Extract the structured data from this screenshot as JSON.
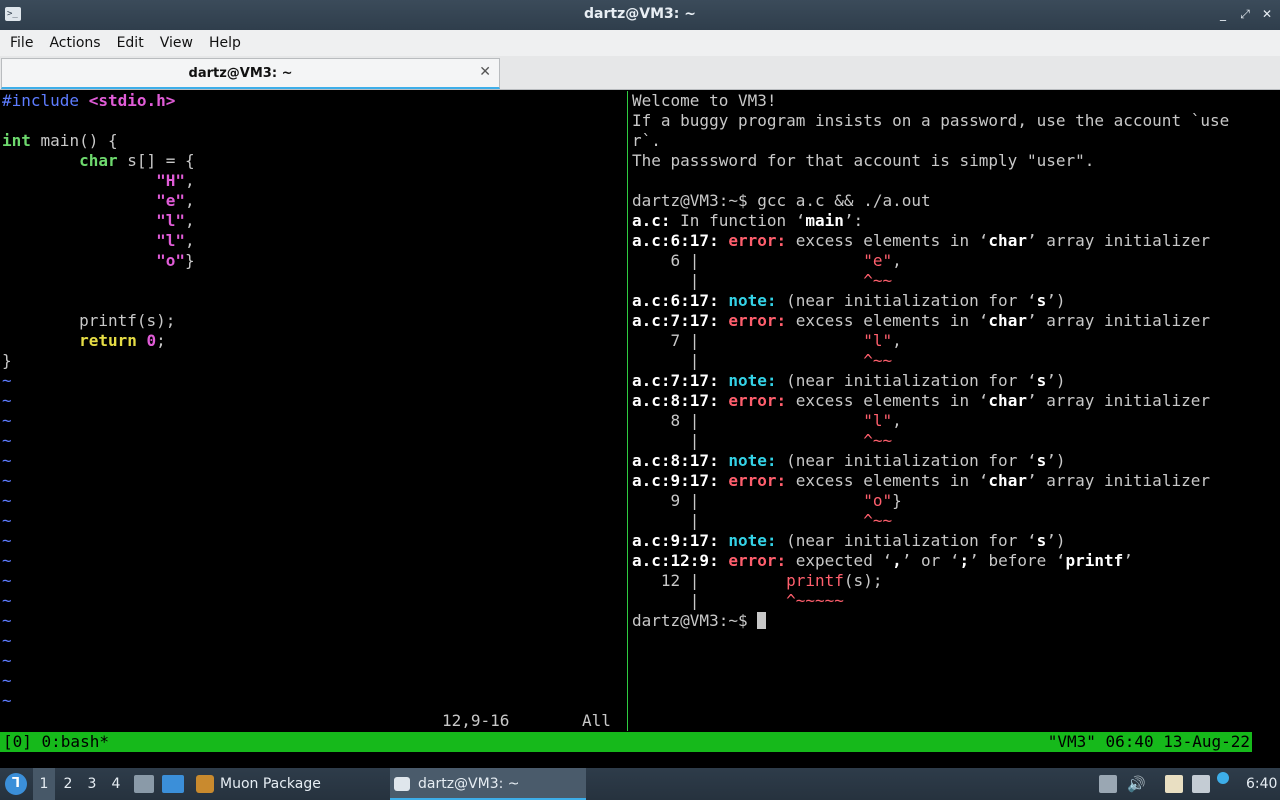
{
  "window": {
    "title": "dartz@VM3: ~",
    "controls": [
      "_",
      "⤢",
      "✕"
    ]
  },
  "menu": [
    "File",
    "Actions",
    "Edit",
    "View",
    "Help"
  ],
  "tab": {
    "label": "dartz@VM3: ~",
    "close": "✕"
  },
  "vim": {
    "lines": [
      [
        [
          "#include ",
          "c-pre"
        ],
        [
          "<stdio.h>",
          "c-inc"
        ]
      ],
      [],
      [
        [
          "int",
          "c-type"
        ],
        [
          " main() {",
          "c-plain"
        ]
      ],
      [
        [
          "        ",
          "c-plain"
        ],
        [
          "char",
          "c-type"
        ],
        [
          " s[] = {",
          "c-plain"
        ]
      ],
      [
        [
          "                ",
          "c-plain"
        ],
        [
          "\"H\"",
          "c-str"
        ],
        [
          ",",
          "c-plain"
        ]
      ],
      [
        [
          "                ",
          "c-plain"
        ],
        [
          "\"e\"",
          "c-str"
        ],
        [
          ",",
          "c-plain"
        ]
      ],
      [
        [
          "                ",
          "c-plain"
        ],
        [
          "\"l\"",
          "c-str"
        ],
        [
          ",",
          "c-plain"
        ]
      ],
      [
        [
          "                ",
          "c-plain"
        ],
        [
          "\"l\"",
          "c-str"
        ],
        [
          ",",
          "c-plain"
        ]
      ],
      [
        [
          "                ",
          "c-plain"
        ],
        [
          "\"o\"",
          "c-str"
        ],
        [
          "}",
          "c-plain"
        ]
      ],
      [],
      [],
      [
        [
          "        printf(s);",
          "c-plain"
        ]
      ],
      [
        [
          "        ",
          "c-plain"
        ],
        [
          "return",
          "c-kw"
        ],
        [
          " ",
          "c-plain"
        ],
        [
          "0",
          "c-num"
        ],
        [
          ";",
          "c-plain"
        ]
      ],
      [
        [
          "}",
          "c-plain"
        ]
      ],
      [
        [
          "~",
          "c-tilde"
        ]
      ],
      [
        [
          "~",
          "c-tilde"
        ]
      ],
      [
        [
          "~",
          "c-tilde"
        ]
      ],
      [
        [
          "~",
          "c-tilde"
        ]
      ],
      [
        [
          "~",
          "c-tilde"
        ]
      ],
      [
        [
          "~",
          "c-tilde"
        ]
      ],
      [
        [
          "~",
          "c-tilde"
        ]
      ],
      [
        [
          "~",
          "c-tilde"
        ]
      ],
      [
        [
          "~",
          "c-tilde"
        ]
      ],
      [
        [
          "~",
          "c-tilde"
        ]
      ],
      [
        [
          "~",
          "c-tilde"
        ]
      ],
      [
        [
          "~",
          "c-tilde"
        ]
      ],
      [
        [
          "~",
          "c-tilde"
        ]
      ],
      [
        [
          "~",
          "c-tilde"
        ]
      ],
      [
        [
          "~",
          "c-tilde"
        ]
      ],
      [
        [
          "~",
          "c-tilde"
        ]
      ],
      [
        [
          "~",
          "c-tilde"
        ]
      ]
    ],
    "ruler_position": "12,9-16",
    "ruler_scroll": "All"
  },
  "shell": {
    "lines": [
      [
        [
          "Welcome to VM3!",
          "c-plain"
        ]
      ],
      [
        [
          "If a buggy program insists on a password, use the account `use",
          "c-plain"
        ]
      ],
      [
        [
          "r`.",
          "c-plain"
        ]
      ],
      [
        [
          "The passsword for that account is simply \"user\".",
          "c-plain"
        ]
      ],
      [],
      [
        [
          "dartz@VM3:~$ gcc a.c && ./a.out",
          "c-plain"
        ]
      ],
      [
        [
          "a.c:",
          "s-bold"
        ],
        [
          " In function ‘",
          "c-plain"
        ],
        [
          "main",
          "s-bold"
        ],
        [
          "’:",
          "c-plain"
        ]
      ],
      [
        [
          "a.c:6:17: ",
          "s-bold"
        ],
        [
          "error:",
          "s-err"
        ],
        [
          " excess elements in ‘",
          "c-plain"
        ],
        [
          "char",
          "s-bold"
        ],
        [
          "’ array initializer",
          "c-plain"
        ]
      ],
      [
        [
          "    6 |                 ",
          "c-plain"
        ],
        [
          "\"e\"",
          "s-red"
        ],
        [
          ",",
          "c-plain"
        ]
      ],
      [
        [
          "      |                 ",
          "c-plain"
        ],
        [
          "^~~",
          "s-red"
        ]
      ],
      [
        [
          "a.c:6:17: ",
          "s-bold"
        ],
        [
          "note:",
          "s-note"
        ],
        [
          " (near initialization for ‘",
          "c-plain"
        ],
        [
          "s",
          "s-bold"
        ],
        [
          "’)",
          "c-plain"
        ]
      ],
      [
        [
          "a.c:7:17: ",
          "s-bold"
        ],
        [
          "error:",
          "s-err"
        ],
        [
          " excess elements in ‘",
          "c-plain"
        ],
        [
          "char",
          "s-bold"
        ],
        [
          "’ array initializer",
          "c-plain"
        ]
      ],
      [
        [
          "    7 |                 ",
          "c-plain"
        ],
        [
          "\"l\"",
          "s-red"
        ],
        [
          ",",
          "c-plain"
        ]
      ],
      [
        [
          "      |                 ",
          "c-plain"
        ],
        [
          "^~~",
          "s-red"
        ]
      ],
      [
        [
          "a.c:7:17: ",
          "s-bold"
        ],
        [
          "note:",
          "s-note"
        ],
        [
          " (near initialization for ‘",
          "c-plain"
        ],
        [
          "s",
          "s-bold"
        ],
        [
          "’)",
          "c-plain"
        ]
      ],
      [
        [
          "a.c:8:17: ",
          "s-bold"
        ],
        [
          "error:",
          "s-err"
        ],
        [
          " excess elements in ‘",
          "c-plain"
        ],
        [
          "char",
          "s-bold"
        ],
        [
          "’ array initializer",
          "c-plain"
        ]
      ],
      [
        [
          "    8 |                 ",
          "c-plain"
        ],
        [
          "\"l\"",
          "s-red"
        ],
        [
          ",",
          "c-plain"
        ]
      ],
      [
        [
          "      |                 ",
          "c-plain"
        ],
        [
          "^~~",
          "s-red"
        ]
      ],
      [
        [
          "a.c:8:17: ",
          "s-bold"
        ],
        [
          "note:",
          "s-note"
        ],
        [
          " (near initialization for ‘",
          "c-plain"
        ],
        [
          "s",
          "s-bold"
        ],
        [
          "’)",
          "c-plain"
        ]
      ],
      [
        [
          "a.c:9:17: ",
          "s-bold"
        ],
        [
          "error:",
          "s-err"
        ],
        [
          " excess elements in ‘",
          "c-plain"
        ],
        [
          "char",
          "s-bold"
        ],
        [
          "’ array initializer",
          "c-plain"
        ]
      ],
      [
        [
          "    9 |                 ",
          "c-plain"
        ],
        [
          "\"o\"",
          "s-red"
        ],
        [
          "}",
          "c-plain"
        ]
      ],
      [
        [
          "      |                 ",
          "c-plain"
        ],
        [
          "^~~",
          "s-red"
        ]
      ],
      [
        [
          "a.c:9:17: ",
          "s-bold"
        ],
        [
          "note:",
          "s-note"
        ],
        [
          " (near initialization for ‘",
          "c-plain"
        ],
        [
          "s",
          "s-bold"
        ],
        [
          "’)",
          "c-plain"
        ]
      ],
      [
        [
          "a.c:12:9: ",
          "s-bold"
        ],
        [
          "error:",
          "s-err"
        ],
        [
          " expected ‘",
          "c-plain"
        ],
        [
          ",",
          "s-bold"
        ],
        [
          "’ or ‘",
          "c-plain"
        ],
        [
          ";",
          "s-bold"
        ],
        [
          "’ before ‘",
          "c-plain"
        ],
        [
          "printf",
          "s-bold"
        ],
        [
          "’",
          "c-plain"
        ]
      ],
      [
        [
          "   12 |         ",
          "c-plain"
        ],
        [
          "printf",
          "s-red"
        ],
        [
          "(s);",
          "c-plain"
        ]
      ],
      [
        [
          "      |         ",
          "c-plain"
        ],
        [
          "^~~~~~",
          "s-red"
        ]
      ],
      [
        [
          "dartz@VM3:~$ ",
          "c-plain"
        ]
      ]
    ]
  },
  "tmux": {
    "left": "[0] 0:bash*",
    "right": "\"VM3\" 06:40 13-Aug-22"
  },
  "taskbar": {
    "workspaces": [
      "1",
      "2",
      "3",
      "4"
    ],
    "tasks": [
      {
        "label": "Muon Package Manager",
        "icon_color": "#c98a2e"
      },
      {
        "label": "dartz@VM3: ~",
        "icon_color": "#3b4b5a"
      }
    ],
    "clock": "6:40"
  },
  "colors": {
    "tmux_green": "#16b91b",
    "pane_divider": "#2ecc40",
    "error_red": "#ff5f6d",
    "note_cyan": "#34d2e6"
  }
}
